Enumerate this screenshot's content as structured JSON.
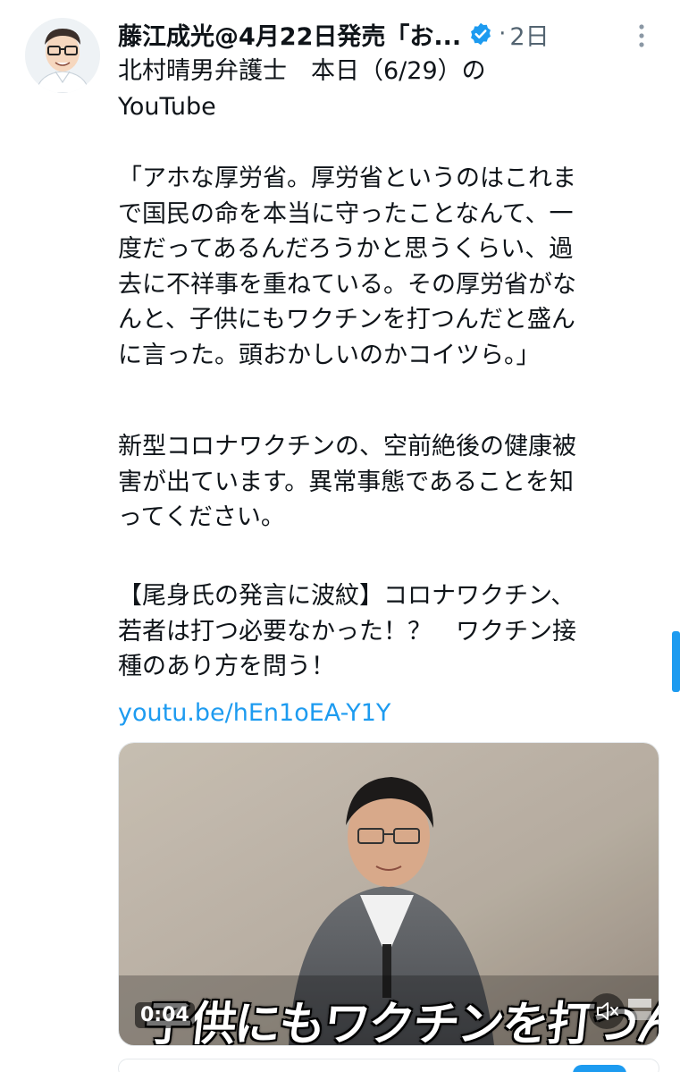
{
  "tweet": {
    "author_name": "藤江成光@4月22日発売「お...",
    "dot": "·",
    "timestamp": "2日",
    "paragraphs": [
      "北村晴男弁護士　本日（6/29）の\nYouTube",
      "「アホな厚労省。厚労省というのはこれま\nで国民の命を本当に守ったことなんて、一\n度だってあるんだろうかと思うくらい、過\n去に不祥事を重ねている。その厚労省がな\nんと、子供にもワクチンを打つんだと盛ん\nに言った。頭おかしいのかコイツら。」",
      "新型コロナワクチンの、空前絶後の健康被\n害が出ています。異常事態であることを知\nってください。",
      "【尾身氏の発言に波紋】コロナワクチン、\n若者は打つ必要なかった！？　ワクチン接\n種のあり方を問う！"
    ],
    "link": "youtu.be/hEn1oEA-Y1Y"
  },
  "video": {
    "caption": "子供にもワクチンを打つんだ",
    "duration": "0:04"
  },
  "icons": {
    "verified": "verified-badge-icon",
    "more": "more-vertical-icon",
    "mute": "speaker-muted-icon"
  },
  "colors": {
    "link": "#1d9bf0",
    "verified": "#1d9bf0",
    "muted_text": "#536471",
    "text": "#0f1419"
  }
}
